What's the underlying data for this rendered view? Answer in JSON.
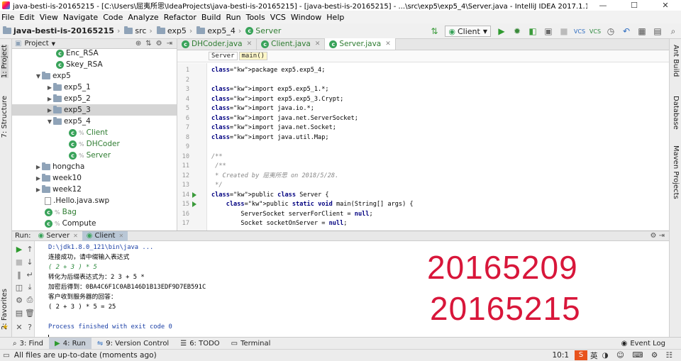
{
  "window": {
    "title": "java-besti-is-20165215 - [C:\\Users\\屈夷所思\\IdeaProjects\\java-besti-is-20165215] - [java-besti-is-20165215] - ...\\src\\exp5\\exp5_4\\Server.java - IntelliJ IDEA 2017.1.1"
  },
  "menu": [
    "File",
    "Edit",
    "View",
    "Navigate",
    "Code",
    "Analyze",
    "Refactor",
    "Build",
    "Run",
    "Tools",
    "VCS",
    "Window",
    "Help"
  ],
  "breadcrumb": [
    "java-besti-is-20165215",
    "src",
    "exp5",
    "exp5_4",
    "Server"
  ],
  "toolbar": {
    "run_config": "Client"
  },
  "left_tabs": {
    "project": "1: Project",
    "structure": "7: Structure",
    "favorites": "2: Favorites"
  },
  "right_tabs": {
    "ant": "Ant Build",
    "database": "Database",
    "maven": "Maven Projects"
  },
  "project_panel": {
    "title": "Project",
    "items": [
      {
        "label": "Enc_RSA",
        "type": "class"
      },
      {
        "label": "Skey_RSA",
        "type": "class"
      },
      {
        "label": "exp5",
        "type": "folder"
      },
      {
        "label": "exp5_1",
        "type": "folder"
      },
      {
        "label": "exp5_2",
        "type": "folder"
      },
      {
        "label": "exp5_3",
        "type": "folder"
      },
      {
        "label": "exp5_4",
        "type": "folder"
      },
      {
        "label": "Client",
        "type": "class"
      },
      {
        "label": "DHCoder",
        "type": "class"
      },
      {
        "label": "Server",
        "type": "class"
      },
      {
        "label": "hongcha",
        "type": "folder"
      },
      {
        "label": "week10",
        "type": "folder"
      },
      {
        "label": "week12",
        "type": "folder"
      },
      {
        "label": ".Hello.java.swp",
        "type": "file"
      },
      {
        "label": "Bag",
        "type": "class"
      },
      {
        "label": "Compute",
        "type": "class"
      }
    ]
  },
  "editor": {
    "tabs": [
      "DHCoder.java",
      "Client.java",
      "Server.java"
    ],
    "crumbs": [
      "Server",
      "main()"
    ],
    "lines": [
      "package exp5.exp5_4;",
      "",
      "import exp5.exp5_1.*;",
      "import exp5.exp5_3.Crypt;",
      "import java.io.*;",
      "import java.net.ServerSocket;",
      "import java.net.Socket;",
      "import java.util.Map;",
      "",
      "/**",
      " /**",
      " * Created by 屈夷所思 on 2018/5/28.",
      " */",
      "public class Server {",
      "    public static void main(String[] args) {",
      "        ServerSocket serverForClient = null;",
      "        Socket socketOnServer = null;"
    ],
    "line_numbers": [
      "1",
      "2",
      "3",
      "4",
      "5",
      "6",
      "7",
      "8",
      "9",
      "10",
      "11",
      "12",
      "13",
      "14",
      "15",
      "16",
      "17"
    ]
  },
  "run_panel": {
    "label": "Run:",
    "tabs": [
      "Server",
      "Client"
    ],
    "console": [
      "D:\\jdk1.8.0_121\\bin\\java ...",
      "连接成功，请中缀输入表达式",
      "( 2 + 3 ) * 5",
      "转化为后缀表达式为：2 3 + 5 *",
      "加密后得到：0BA4C6F1C0AB146D1B13EDF9D7EB591C",
      "客户收到服务器的回答：",
      "( 2 + 3 ) * 5 = 25",
      "",
      "Process finished with exit code 0"
    ],
    "overlay": [
      "20165209",
      "20165215"
    ]
  },
  "bottom_tabs": [
    "3: Find",
    "4: Run",
    "9: Version Control",
    "6: TODO",
    "Terminal"
  ],
  "event_log": "Event Log",
  "status": {
    "message": "All files are up-to-date (moments ago)",
    "position": "10:1",
    "ime": "英"
  }
}
